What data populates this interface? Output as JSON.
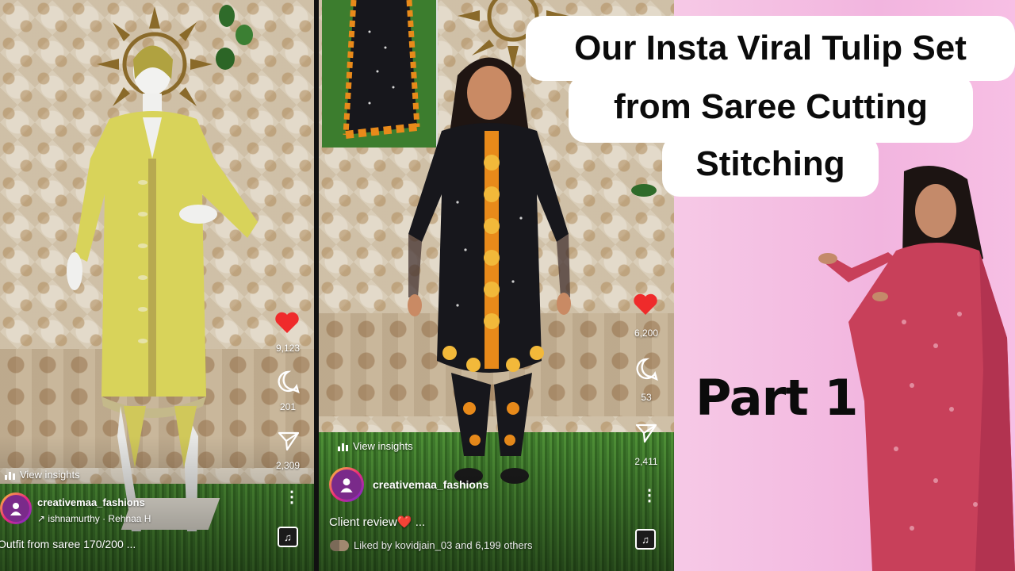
{
  "left_reel": {
    "likes": "9,123",
    "comments": "201",
    "shares": "2,309",
    "insights_label": "View insights",
    "username": "creativemaa_fashions",
    "collab_text": "ishnamurthy · Rehnaa H",
    "caption": "Outfit from saree 170/200 ..."
  },
  "middle_reel": {
    "likes": "6,200",
    "comments": "53",
    "shares": "2,411",
    "insights_label": "View insights",
    "username": "creativemaa_fashions",
    "caption": "Client review❤️ ...",
    "liked_by": "Liked by kovidjain_03 and 6,199 others"
  },
  "promo": {
    "title_line1": "Our Insta Viral Tulip Set",
    "title_line2": "from Saree Cutting",
    "title_line3": "Stitching",
    "part_label": "Part 1"
  },
  "icons": [
    "heart-icon",
    "comment-icon",
    "share-icon",
    "more-icon",
    "music-icon",
    "bar-chart-icon"
  ],
  "colors": {
    "heart": "#ef2b2b",
    "promo_background": "#f4bfe2",
    "left_outfit": "#d9d35a",
    "middle_outfit": "#17171c",
    "right_outfit": "#c8405a"
  }
}
